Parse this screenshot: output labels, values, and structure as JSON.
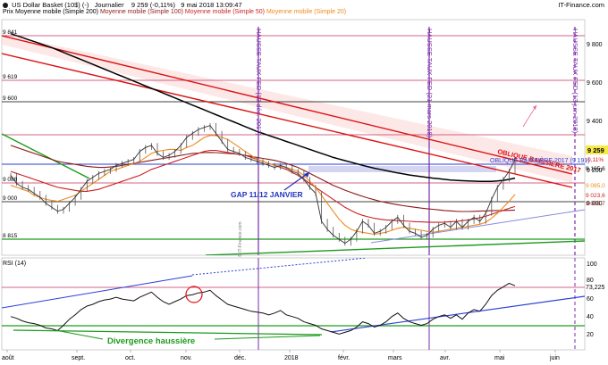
{
  "header": {
    "title": "US Dollar Basket (10$) (-)",
    "period": "Journalier",
    "last": "9 259 (-0,11%)",
    "date": "9 mai 2018 13:09:47",
    "brand": "IT-Finance.com",
    "legend": [
      {
        "label": "Prix Moyenne mobile (Simple 200)",
        "color": "#000000"
      },
      {
        "label": "Moyenne mobile (Simple 100)",
        "color": "#8b1a1a"
      },
      {
        "label": "Moyenne mobile (Simple 50)",
        "color": "#cc2222"
      },
      {
        "label": "Moyenne mobile (Simple 20)",
        "color": "#ee8a1a"
      }
    ]
  },
  "chart_data": [
    {
      "type": "line",
      "price_ticks": [
        "9 800",
        "9 600",
        "9 400",
        "9 200",
        "9 000"
      ],
      "left_levels": [
        "9 841",
        "9 619",
        "9 600",
        "9 088",
        "9 000",
        "8 815"
      ],
      "right_labels": {
        "last": "9 259",
        "change": "-0,11%",
        "level_1": "9 165,6",
        "level_2": "9 085,0",
        "level_3": "9 023,6",
        "level_4": "9 005,7"
      },
      "ylim": [
        8780,
        9960
      ],
      "annotations": {
        "gap": "GAP 11/12 JANVIER",
        "fed_1": "HAUSSE TAUX FED (13 déc. 2017)",
        "fed_2": "HAUSSE TAUX FED (21 mars 2018)",
        "fed_3": "HAUSSE TAUX FED (13 juin 2018)",
        "oblique_1": "OBLIQUE BAISSIÈRE 2017",
        "oblique_2": "OBLIQUE BAISSIÈRE 2017 (9 191)",
        "watermark": "© IT-Finance.com"
      },
      "price": [
        9180,
        9140,
        9120,
        9110,
        9090,
        9070,
        9040,
        9020,
        9000,
        9010,
        9040,
        9070,
        9110,
        9150,
        9170,
        9190,
        9200,
        9210,
        9230,
        9240,
        9250,
        9260,
        9300,
        9320,
        9330,
        9290,
        9270,
        9280,
        9300,
        9330,
        9370,
        9390,
        9410,
        9420,
        9430,
        9390,
        9350,
        9310,
        9300,
        9290,
        9270,
        9260,
        9250,
        9240,
        9230,
        9220,
        9230,
        9220,
        9200,
        9190,
        9160,
        9120,
        9090,
        8950,
        8910,
        8880,
        8860,
        8840,
        8860,
        8900,
        8950,
        8930,
        8890,
        8900,
        8920,
        8950,
        8970,
        8930,
        8900,
        8890,
        8870,
        8880,
        8910,
        8930,
        8940,
        8920,
        8950,
        8920,
        8950,
        8970,
        8950,
        8990,
        9060,
        9120,
        9160,
        9200,
        9259
      ],
      "sma20": [
        9130,
        9120,
        9110,
        9100,
        9080,
        9070,
        9060,
        9055,
        9050,
        9060,
        9070,
        9080,
        9100,
        9120,
        9140,
        9160,
        9180,
        9200,
        9210,
        9220,
        9230,
        9240,
        9250,
        9270,
        9290,
        9300,
        9305,
        9310,
        9310,
        9305,
        9320,
        9330,
        9350,
        9370,
        9380,
        9380,
        9370,
        9360,
        9340,
        9320,
        9300,
        9280,
        9260,
        9250,
        9240,
        9230,
        9225,
        9220,
        9210,
        9200,
        9180,
        9150,
        9120,
        9080,
        9040,
        9000,
        8960,
        8930,
        8910,
        8900,
        8895,
        8890,
        8885,
        8890,
        8895,
        8905,
        8915,
        8920,
        8915,
        8910,
        8905,
        8900,
        8895,
        8900,
        8905,
        8910,
        8915,
        8920,
        8925,
        8930,
        8935,
        8945,
        8965,
        8990,
        9020,
        9050,
        9085
      ],
      "sma50": [
        9200,
        9190,
        9180,
        9170,
        9160,
        9150,
        9140,
        9130,
        9120,
        9115,
        9110,
        9105,
        9100,
        9100,
        9105,
        9110,
        9120,
        9130,
        9140,
        9150,
        9160,
        9170,
        9180,
        9195,
        9210,
        9220,
        9230,
        9240,
        9250,
        9260,
        9270,
        9280,
        9290,
        9300,
        9305,
        9305,
        9300,
        9295,
        9290,
        9285,
        9280,
        9270,
        9260,
        9250,
        9240,
        9230,
        9220,
        9210,
        9195,
        9180,
        9160,
        9140,
        9120,
        9100,
        9080,
        9060,
        9040,
        9020,
        9005,
        8990,
        8980,
        8972,
        8965,
        8960,
        8957,
        8955,
        8953,
        8952,
        8950,
        8948,
        8947,
        8946,
        8945,
        8945,
        8946,
        8948,
        8950,
        8953,
        8957,
        8962,
        8968,
        8975,
        8985,
        8995,
        9005,
        9015,
        9024
      ],
      "sma100": [
        9330,
        9320,
        9310,
        9300,
        9290,
        9280,
        9270,
        9260,
        9250,
        9245,
        9240,
        9235,
        9230,
        9225,
        9222,
        9220,
        9220,
        9222,
        9225,
        9230,
        9235,
        9240,
        9245,
        9250,
        9255,
        9260,
        9265,
        9270,
        9275,
        9280,
        9285,
        9290,
        9292,
        9294,
        9295,
        9294,
        9292,
        9290,
        9288,
        9285,
        9280,
        9275,
        9270,
        9265,
        9260,
        9255,
        9248,
        9240,
        9230,
        9220,
        9205,
        9190,
        9175,
        9160,
        9145,
        9130,
        9118,
        9106,
        9095,
        9085,
        9075,
        9066,
        9058,
        9050,
        9044,
        9038,
        9033,
        9028,
        9024,
        9020,
        9016,
        9013,
        9010,
        9007,
        9004,
        9002,
        9000,
        8999,
        8999,
        9000,
        9001,
        9002,
        9003,
        9004,
        9004,
        9005,
        9006
      ],
      "sma200": [
        9890,
        9880,
        9870,
        9860,
        9850,
        9840,
        9830,
        9820,
        9808,
        9796,
        9784,
        9772,
        9760,
        9748,
        9736,
        9724,
        9712,
        9700,
        9688,
        9676,
        9664,
        9652,
        9640,
        9628,
        9616,
        9604,
        9592,
        9580,
        9568,
        9556,
        9544,
        9532,
        9520,
        9508,
        9496,
        9484,
        9472,
        9460,
        9448,
        9436,
        9424,
        9412,
        9400,
        9390,
        9380,
        9370,
        9360,
        9350,
        9340,
        9330,
        9320,
        9310,
        9300,
        9290,
        9280,
        9270,
        9262,
        9254,
        9246,
        9238,
        9230,
        9223,
        9216,
        9210,
        9204,
        9198,
        9192,
        9187,
        9182,
        9178,
        9174,
        9170,
        9166,
        9163,
        9160,
        9157,
        9155,
        9153,
        9152,
        9151,
        9150,
        9150,
        9150,
        9152,
        9155,
        9160,
        9166
      ]
    },
    {
      "type": "line",
      "title": "RSI (14)",
      "yticks": [
        "100",
        "80",
        "60",
        "40",
        "20"
      ],
      "current": "73,225",
      "ylim": [
        0,
        105
      ],
      "xticks": [
        "août",
        "sept.",
        "oct.",
        "nov.",
        "déc.",
        "2018",
        "févr.",
        "mars",
        "avr.",
        "mai",
        "juin"
      ],
      "annotations": {
        "divergence": "Divergence haussière"
      },
      "values": [
        38,
        36,
        33,
        31,
        30,
        28,
        25,
        24,
        22,
        28,
        35,
        40,
        46,
        50,
        52,
        55,
        57,
        58,
        60,
        58,
        57,
        56,
        60,
        63,
        66,
        60,
        55,
        52,
        55,
        58,
        62,
        63,
        65,
        66,
        68,
        62,
        57,
        52,
        50,
        48,
        46,
        44,
        43,
        42,
        40,
        42,
        45,
        40,
        38,
        36,
        32,
        30,
        28,
        24,
        22,
        20,
        18,
        20,
        22,
        26,
        32,
        30,
        26,
        28,
        32,
        38,
        42,
        36,
        32,
        30,
        28,
        30,
        35,
        38,
        40,
        36,
        40,
        35,
        42,
        46,
        44,
        52,
        62,
        68,
        72,
        76,
        73.2
      ]
    }
  ]
}
